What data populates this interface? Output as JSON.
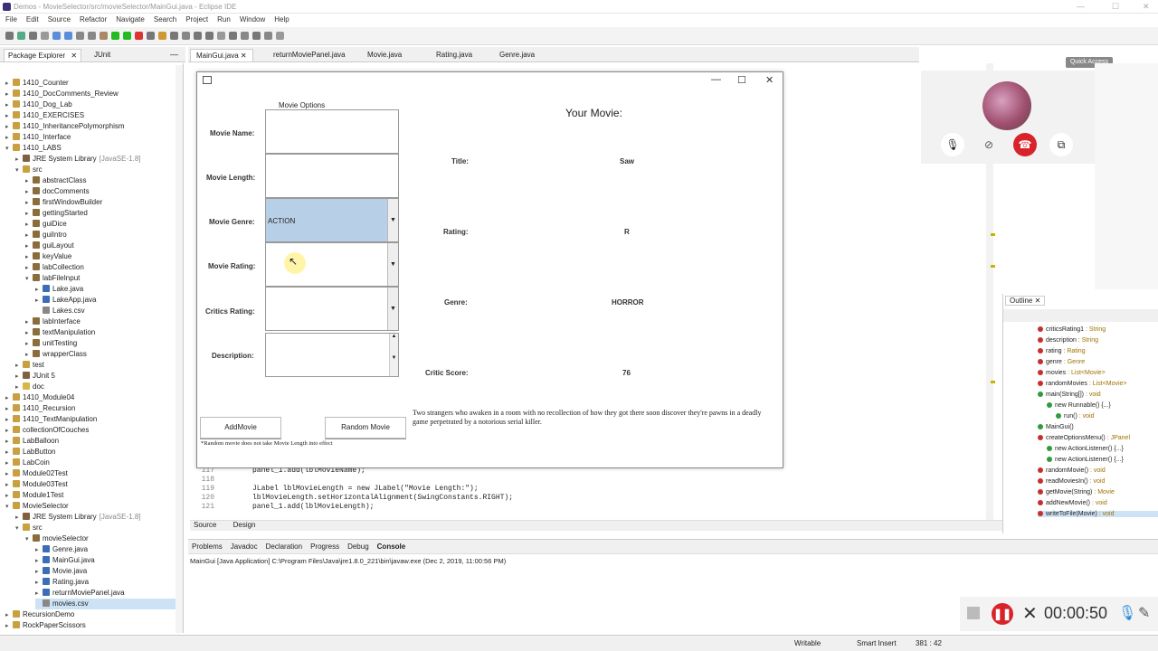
{
  "window": {
    "title": "Demos - MovieSelector/src/movieSelector/MainGui.java - Eclipse IDE"
  },
  "menu": [
    "File",
    "Edit",
    "Source",
    "Refactor",
    "Navigate",
    "Search",
    "Project",
    "Run",
    "Window",
    "Help"
  ],
  "quick_access": "Quick Access",
  "package_explorer": {
    "tabs": [
      "Package Explorer",
      "JUnit"
    ],
    "items": [
      {
        "label": "1410_Counter",
        "indent": 0,
        "arrow": "▸",
        "icon": "project"
      },
      {
        "label": "1410_DocComments_Review",
        "indent": 0,
        "arrow": "▸",
        "icon": "project"
      },
      {
        "label": "1410_Dog_Lab",
        "indent": 0,
        "arrow": "▸",
        "icon": "project"
      },
      {
        "label": "1410_EXERCISES",
        "indent": 0,
        "arrow": "▸",
        "icon": "project"
      },
      {
        "label": "1410_InheritancePolymorphism",
        "indent": 0,
        "arrow": "▸",
        "icon": "project"
      },
      {
        "label": "1410_Interface",
        "indent": 0,
        "arrow": "▸",
        "icon": "project"
      },
      {
        "label": "1410_LABS",
        "indent": 0,
        "arrow": "▾",
        "icon": "project"
      },
      {
        "label": "JRE System Library",
        "suffix": "[JavaSE-1.8]",
        "indent": 1,
        "arrow": "▸",
        "icon": "lib"
      },
      {
        "label": "src",
        "indent": 1,
        "arrow": "▾",
        "icon": "src"
      },
      {
        "label": "abstractClass",
        "indent": 2,
        "arrow": "▸",
        "icon": "pkg"
      },
      {
        "label": "docComments",
        "indent": 2,
        "arrow": "▸",
        "icon": "pkg"
      },
      {
        "label": "firstWindowBuilder",
        "indent": 2,
        "arrow": "▸",
        "icon": "pkg"
      },
      {
        "label": "gettingStarted",
        "indent": 2,
        "arrow": "▸",
        "icon": "pkg"
      },
      {
        "label": "guiDice",
        "indent": 2,
        "arrow": "▸",
        "icon": "pkg"
      },
      {
        "label": "guiIntro",
        "indent": 2,
        "arrow": "▸",
        "icon": "pkg"
      },
      {
        "label": "guiLayout",
        "indent": 2,
        "arrow": "▸",
        "icon": "pkg"
      },
      {
        "label": "keyValue",
        "indent": 2,
        "arrow": "▸",
        "icon": "pkg"
      },
      {
        "label": "labCollection",
        "indent": 2,
        "arrow": "▸",
        "icon": "pkg"
      },
      {
        "label": "labFileInput",
        "indent": 2,
        "arrow": "▾",
        "icon": "pkg"
      },
      {
        "label": "Lake.java",
        "indent": 3,
        "arrow": "▸",
        "icon": "java"
      },
      {
        "label": "LakeApp.java",
        "indent": 3,
        "arrow": "▸",
        "icon": "java"
      },
      {
        "label": "Lakes.csv",
        "indent": 3,
        "arrow": "",
        "icon": "file"
      },
      {
        "label": "labInterface",
        "indent": 2,
        "arrow": "▸",
        "icon": "pkg"
      },
      {
        "label": "textManipulation",
        "indent": 2,
        "arrow": "▸",
        "icon": "pkg"
      },
      {
        "label": "unitTesting",
        "indent": 2,
        "arrow": "▸",
        "icon": "pkg"
      },
      {
        "label": "wrapperClass",
        "indent": 2,
        "arrow": "▸",
        "icon": "pkg"
      },
      {
        "label": "test",
        "indent": 1,
        "arrow": "▸",
        "icon": "src"
      },
      {
        "label": "JUnit 5",
        "indent": 1,
        "arrow": "▸",
        "icon": "lib"
      },
      {
        "label": "doc",
        "indent": 1,
        "arrow": "▸",
        "icon": "folder"
      },
      {
        "label": "1410_Module04",
        "indent": 0,
        "arrow": "▸",
        "icon": "project"
      },
      {
        "label": "1410_Recursion",
        "indent": 0,
        "arrow": "▸",
        "icon": "project"
      },
      {
        "label": "1410_TextManipulation",
        "indent": 0,
        "arrow": "▸",
        "icon": "project"
      },
      {
        "label": "collectionOfCouches",
        "indent": 0,
        "arrow": "▸",
        "icon": "project"
      },
      {
        "label": "LabBalloon",
        "indent": 0,
        "arrow": "▸",
        "icon": "project"
      },
      {
        "label": "LabButton",
        "indent": 0,
        "arrow": "▸",
        "icon": "project"
      },
      {
        "label": "LabCoin",
        "indent": 0,
        "arrow": "▸",
        "icon": "project"
      },
      {
        "label": "Module02Test",
        "indent": 0,
        "arrow": "▸",
        "icon": "project"
      },
      {
        "label": "Module03Test",
        "indent": 0,
        "arrow": "▸",
        "icon": "project"
      },
      {
        "label": "Module1Test",
        "indent": 0,
        "arrow": "▸",
        "icon": "project"
      },
      {
        "label": "MovieSelector",
        "indent": 0,
        "arrow": "▾",
        "icon": "project"
      },
      {
        "label": "JRE System Library",
        "suffix": "[JavaSE-1.8]",
        "indent": 1,
        "arrow": "▸",
        "icon": "lib"
      },
      {
        "label": "src",
        "indent": 1,
        "arrow": "▾",
        "icon": "src"
      },
      {
        "label": "movieSelector",
        "indent": 2,
        "arrow": "▾",
        "icon": "pkg"
      },
      {
        "label": "Genre.java",
        "indent": 3,
        "arrow": "▸",
        "icon": "java"
      },
      {
        "label": "MainGui.java",
        "indent": 3,
        "arrow": "▸",
        "icon": "java"
      },
      {
        "label": "Movie.java",
        "indent": 3,
        "arrow": "▸",
        "icon": "java"
      },
      {
        "label": "Rating.java",
        "indent": 3,
        "arrow": "▸",
        "icon": "java"
      },
      {
        "label": "returnMoviePanel.java",
        "indent": 3,
        "arrow": "▸",
        "icon": "java"
      },
      {
        "label": "movies.csv",
        "indent": 3,
        "arrow": "",
        "icon": "file",
        "selected": true
      },
      {
        "label": "RecursionDemo",
        "indent": 0,
        "arrow": "▸",
        "icon": "project"
      },
      {
        "label": "RockPaperScissors",
        "indent": 0,
        "arrow": "▸",
        "icon": "project"
      }
    ]
  },
  "editor_tabs": [
    "MainGui.java",
    "returnMoviePanel.java",
    "Movie.java",
    "Rating.java",
    "Genre.java"
  ],
  "code": [
    {
      "n": "117",
      "html": "panel_1.add(lblMovieName);"
    },
    {
      "n": "118",
      "html": ""
    },
    {
      "n": "119",
      "html": "JLabel lblMovieLength = new JLabel(\"Movie Length:\");"
    },
    {
      "n": "120",
      "html": "lblMovieLength.setHorizontalAlignment(SwingConstants.RIGHT);"
    },
    {
      "n": "121",
      "html": "panel_1.add(lblMovieLength);"
    }
  ],
  "source_tabs": [
    "Source",
    "Design"
  ],
  "app": {
    "options_title": "Movie Options",
    "labels": {
      "name": "Movie Name:",
      "length": "Movie Length:",
      "genre": "Movie Genre:",
      "rating": "Movie Rating:",
      "critics": "Critics Rating:",
      "description": "Description:"
    },
    "genre_value": "ACTION",
    "add_button": "AddMovie",
    "random_button": "Random Movie",
    "footnote": "*Random movie does not take Movie Length into effect",
    "your_movie": "Your Movie:",
    "result_labels": {
      "title": "Title:",
      "rating": "Rating:",
      "genre": "Genre:",
      "critic": "Critic Score:"
    },
    "result_values": {
      "title": "Saw",
      "rating": "R",
      "genre": "HORROR",
      "critic": "76"
    },
    "description_text": "Two strangers who awaken in a room with no recollection of how they got there soon discover they're pawns in a deadly game perpetrated by a notorious serial killer."
  },
  "outline": {
    "title": "Outline",
    "items": [
      {
        "label": "criticsRating1",
        "type": " : String",
        "indent": 0,
        "color": "#c62f2f"
      },
      {
        "label": "description",
        "type": " : String",
        "indent": 0,
        "color": "#c62f2f"
      },
      {
        "label": "rating",
        "type": " : Rating",
        "indent": 0,
        "color": "#c62f2f"
      },
      {
        "label": "genre",
        "type": " : Genre",
        "indent": 0,
        "color": "#c62f2f"
      },
      {
        "label": "movies",
        "type": " : List<Movie>",
        "indent": 0,
        "color": "#c62f2f"
      },
      {
        "label": "randomMovies",
        "type": " : List<Movie>",
        "indent": 0,
        "color": "#c62f2f"
      },
      {
        "label": "main(String[])",
        "type": " : void",
        "indent": 0,
        "color": "#2f9b3a"
      },
      {
        "label": "new Runnable() {...}",
        "type": "",
        "indent": 1,
        "color": "#2f9b3a"
      },
      {
        "label": "run()",
        "type": " : void",
        "indent": 2,
        "color": "#2f9b3a"
      },
      {
        "label": "MainGui()",
        "type": "",
        "indent": 0,
        "color": "#2f9b3a"
      },
      {
        "label": "createOptionsMenu()",
        "type": " : JPanel",
        "indent": 0,
        "color": "#c62f2f"
      },
      {
        "label": "new ActionListener() {...}",
        "type": "",
        "indent": 1,
        "color": "#2f9b3a"
      },
      {
        "label": "new ActionListener() {...}",
        "type": "",
        "indent": 1,
        "color": "#2f9b3a"
      },
      {
        "label": "randomMovie()",
        "type": " : void",
        "indent": 0,
        "color": "#c62f2f"
      },
      {
        "label": "readMoviesIn()",
        "type": " : void",
        "indent": 0,
        "color": "#c62f2f"
      },
      {
        "label": "getMovie(String)",
        "type": " : Movie",
        "indent": 0,
        "color": "#c62f2f"
      },
      {
        "label": "addNewMovie()",
        "type": " : void",
        "indent": 0,
        "color": "#c62f2f"
      },
      {
        "label": "writeToFile(Movie)",
        "type": " : void",
        "indent": 0,
        "color": "#c62f2f",
        "selected": true
      }
    ]
  },
  "console": {
    "tabs": [
      "Problems",
      "Javadoc",
      "Declaration",
      "Progress",
      "Debug",
      "Console"
    ],
    "line": "MainGui [Java Application] C:\\Program Files\\Java\\jre1.8.0_221\\bin\\javaw.exe (Dec 2, 2019, 11:00:56 PM)"
  },
  "status": {
    "writable": "Writable",
    "insert": "Smart Insert",
    "position": "381 : 42"
  },
  "recorder": {
    "time": "00:00:50"
  }
}
